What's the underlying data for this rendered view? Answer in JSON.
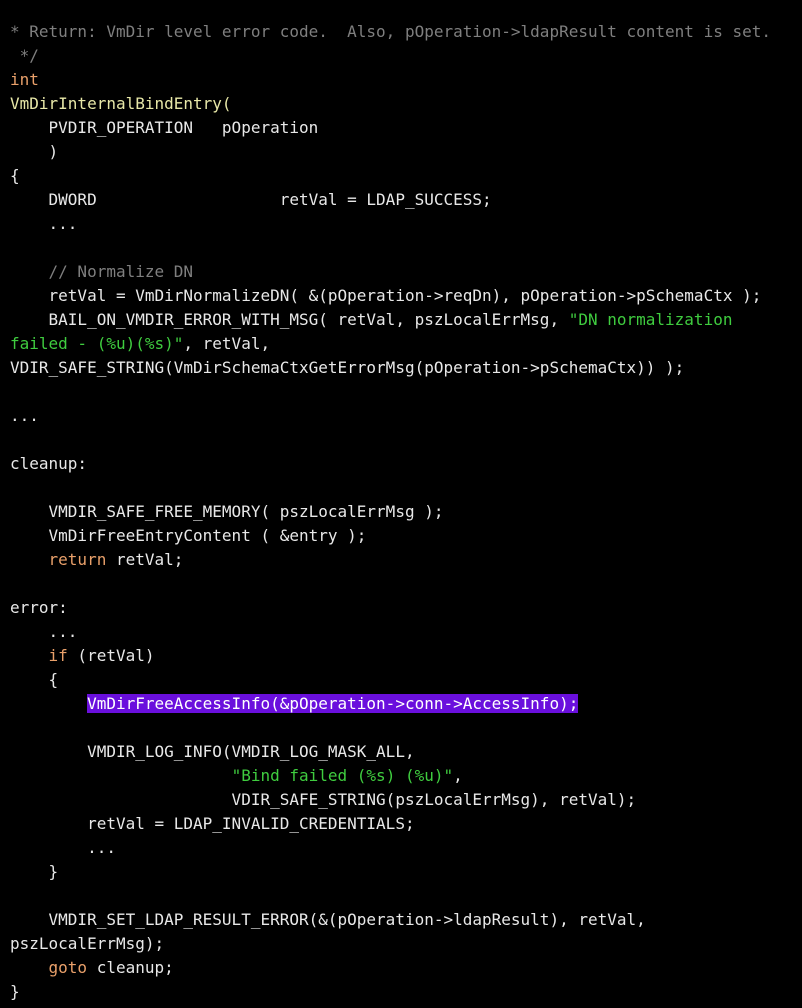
{
  "view": {
    "kind": "source-code-snippet",
    "language": "C",
    "background_color": "#000000",
    "default_text_color": "#e8e8e8"
  },
  "colors": {
    "comment": "#7f7f7f",
    "keyword": "#e9a06a",
    "string": "#3fcc3f",
    "function_name": "#e8e8a8",
    "plain": "#e8e8e8",
    "highlight_background": "#6a0fdd",
    "highlight_text": "#ffffff"
  },
  "lines": [
    {
      "id": "line-1",
      "tokens": [
        {
          "text": "* Return: VmDir level error code.  Also, pOperation->ldapResult content is set.",
          "style": "comment"
        }
      ]
    },
    {
      "id": "line-2",
      "tokens": [
        {
          "text": " */",
          "style": "comment"
        }
      ]
    },
    {
      "id": "line-3",
      "tokens": [
        {
          "text": "int",
          "style": "keyword"
        }
      ]
    },
    {
      "id": "line-4",
      "tokens": [
        {
          "text": "VmDirInternalBindEntry(",
          "style": "function"
        }
      ]
    },
    {
      "id": "line-5",
      "tokens": [
        {
          "text": "    PVDIR_OPERATION   pOperation",
          "style": "plain"
        }
      ]
    },
    {
      "id": "line-6",
      "tokens": [
        {
          "text": "    )",
          "style": "plain"
        }
      ]
    },
    {
      "id": "line-7",
      "tokens": [
        {
          "text": "{",
          "style": "plain"
        }
      ]
    },
    {
      "id": "line-8",
      "tokens": [
        {
          "text": "    DWORD                   retVal = LDAP_SUCCESS;",
          "style": "plain"
        }
      ]
    },
    {
      "id": "line-9",
      "tokens": [
        {
          "text": "    ...",
          "style": "plain"
        }
      ]
    },
    {
      "id": "line-10",
      "tokens": [
        {
          "text": "",
          "style": "plain"
        }
      ]
    },
    {
      "id": "line-11",
      "tokens": [
        {
          "text": "    ",
          "style": "plain"
        },
        {
          "text": "// Normalize DN",
          "style": "comment"
        }
      ]
    },
    {
      "id": "line-12",
      "tokens": [
        {
          "text": "    retVal = VmDirNormalizeDN( &(pOperation->reqDn), pOperation->pSchemaCtx );",
          "style": "plain"
        }
      ]
    },
    {
      "id": "line-13",
      "tokens": [
        {
          "text": "    BAIL_ON_VMDIR_ERROR_WITH_MSG( retVal, pszLocalErrMsg, ",
          "style": "plain"
        },
        {
          "text": "\"DN normalization",
          "style": "string"
        }
      ]
    },
    {
      "id": "line-14",
      "tokens": [
        {
          "text": "failed - (%u)(%s)\"",
          "style": "string"
        },
        {
          "text": ", retVal,",
          "style": "plain"
        }
      ]
    },
    {
      "id": "line-15",
      "tokens": [
        {
          "text": "VDIR_SAFE_STRING(VmDirSchemaCtxGetErrorMsg(pOperation->pSchemaCtx)) );",
          "style": "plain"
        }
      ]
    },
    {
      "id": "line-16",
      "tokens": [
        {
          "text": "",
          "style": "plain"
        }
      ]
    },
    {
      "id": "line-17",
      "tokens": [
        {
          "text": "...",
          "style": "plain"
        }
      ]
    },
    {
      "id": "line-18",
      "tokens": [
        {
          "text": "",
          "style": "plain"
        }
      ]
    },
    {
      "id": "line-19",
      "tokens": [
        {
          "text": "cleanup:",
          "style": "label"
        }
      ]
    },
    {
      "id": "line-20",
      "tokens": [
        {
          "text": "",
          "style": "plain"
        }
      ]
    },
    {
      "id": "line-21",
      "tokens": [
        {
          "text": "    VMDIR_SAFE_FREE_MEMORY( pszLocalErrMsg );",
          "style": "plain"
        }
      ]
    },
    {
      "id": "line-22",
      "tokens": [
        {
          "text": "    VmDirFreeEntryContent ( &entry );",
          "style": "plain"
        }
      ]
    },
    {
      "id": "line-23",
      "tokens": [
        {
          "text": "    ",
          "style": "plain"
        },
        {
          "text": "return",
          "style": "keyword"
        },
        {
          "text": " retVal;",
          "style": "plain"
        }
      ]
    },
    {
      "id": "line-24",
      "tokens": [
        {
          "text": "",
          "style": "plain"
        }
      ]
    },
    {
      "id": "line-25",
      "tokens": [
        {
          "text": "error:",
          "style": "label"
        }
      ]
    },
    {
      "id": "line-26",
      "tokens": [
        {
          "text": "    ...",
          "style": "plain"
        }
      ]
    },
    {
      "id": "line-27",
      "tokens": [
        {
          "text": "    ",
          "style": "plain"
        },
        {
          "text": "if",
          "style": "keyword"
        },
        {
          "text": " (retVal)",
          "style": "plain"
        }
      ]
    },
    {
      "id": "line-28",
      "tokens": [
        {
          "text": "    {",
          "style": "plain"
        }
      ]
    },
    {
      "id": "line-29",
      "tokens": [
        {
          "text": "        ",
          "style": "plain"
        },
        {
          "text": "VmDirFreeAccessInfo(&pOperation->conn->AccessInfo);",
          "style": "highlight"
        }
      ]
    },
    {
      "id": "line-30",
      "tokens": [
        {
          "text": "",
          "style": "plain"
        }
      ]
    },
    {
      "id": "line-31",
      "tokens": [
        {
          "text": "        VMDIR_LOG_INFO(VMDIR_LOG_MASK_ALL,",
          "style": "plain"
        }
      ]
    },
    {
      "id": "line-32",
      "tokens": [
        {
          "text": "                       ",
          "style": "plain"
        },
        {
          "text": "\"Bind failed (%s) (%u)\"",
          "style": "string"
        },
        {
          "text": ",",
          "style": "plain"
        }
      ]
    },
    {
      "id": "line-33",
      "tokens": [
        {
          "text": "                       VDIR_SAFE_STRING(pszLocalErrMsg), retVal);",
          "style": "plain"
        }
      ]
    },
    {
      "id": "line-34",
      "tokens": [
        {
          "text": "        retVal = LDAP_INVALID_CREDENTIALS;",
          "style": "plain"
        }
      ]
    },
    {
      "id": "line-35",
      "tokens": [
        {
          "text": "        ...",
          "style": "plain"
        }
      ]
    },
    {
      "id": "line-36",
      "tokens": [
        {
          "text": "    }",
          "style": "plain"
        }
      ]
    },
    {
      "id": "line-37",
      "tokens": [
        {
          "text": "",
          "style": "plain"
        }
      ]
    },
    {
      "id": "line-38",
      "tokens": [
        {
          "text": "    VMDIR_SET_LDAP_RESULT_ERROR(&(pOperation->ldapResult), retVal,",
          "style": "plain"
        }
      ]
    },
    {
      "id": "line-39",
      "tokens": [
        {
          "text": "pszLocalErrMsg);",
          "style": "plain"
        }
      ]
    },
    {
      "id": "line-40",
      "tokens": [
        {
          "text": "    ",
          "style": "plain"
        },
        {
          "text": "goto",
          "style": "keyword"
        },
        {
          "text": " cleanup;",
          "style": "plain"
        }
      ]
    },
    {
      "id": "line-41",
      "tokens": [
        {
          "text": "}",
          "style": "plain"
        }
      ]
    }
  ]
}
